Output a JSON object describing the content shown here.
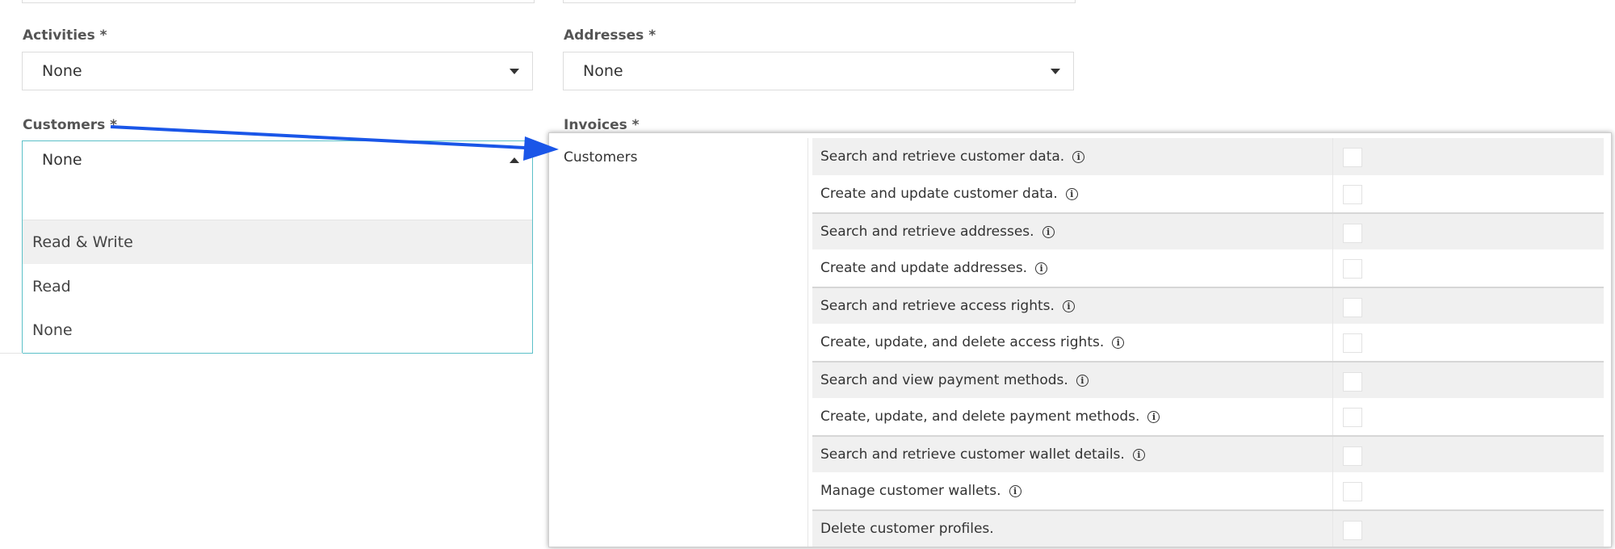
{
  "fields": {
    "activities": {
      "label": "Activities *",
      "value": "None"
    },
    "addresses": {
      "label": "Addresses *",
      "value": "None"
    },
    "customers": {
      "label": "Customers *",
      "value": "None"
    },
    "invoices": {
      "label": "Invoices *"
    }
  },
  "dropdown": {
    "search_value": "",
    "options": [
      "Read & Write",
      "Read",
      "None"
    ]
  },
  "popup": {
    "group_label": "Customers",
    "permissions": [
      "Search and retrieve customer data.",
      "Create and update customer data.",
      "Search and retrieve addresses.",
      "Create and update addresses.",
      "Search and retrieve access rights.",
      "Create, update, and delete access rights.",
      "Search and view payment methods.",
      "Create, update, and delete payment methods.",
      "Search and retrieve customer wallet details.",
      "Manage customer wallets.",
      "Delete customer profiles."
    ]
  },
  "icons": {
    "info": "info-icon",
    "annotation": "blue-arrow"
  },
  "colors": {
    "arrow": "#1a56e8",
    "focus_border": "#5bc0c8"
  }
}
